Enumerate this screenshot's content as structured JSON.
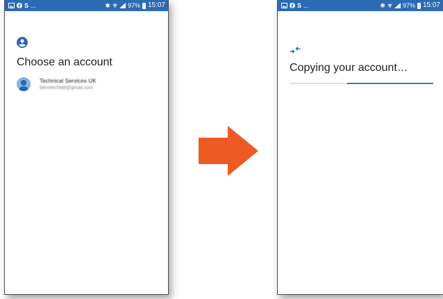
{
  "left_screen": {
    "status_bar": {
      "left_icons": [
        "image-icon",
        "facebook-icon",
        "s-icon",
        "more-dots"
      ],
      "left_s": "S",
      "left_dots": "...",
      "right": {
        "bluetooth": "✱",
        "battery": "97%",
        "time": "15:07"
      }
    },
    "title": "Choose an account",
    "account": {
      "name": "Technical Services UK",
      "email": "benetechlab@gmail.com"
    }
  },
  "right_screen": {
    "status_bar": {
      "left_s": "S",
      "left_dots": "...",
      "right": {
        "bluetooth": "✱",
        "battery": "97%",
        "time": "15:07"
      }
    },
    "title": "Copying your account…",
    "progress": {
      "buffer_fraction": 1.0,
      "indicator_start_fraction": 0.4,
      "indicator_end_fraction": 1.0
    }
  },
  "colors": {
    "status_bar": "#2c6ab4",
    "accent": "#2a67b1",
    "arrow": "#ee5a24"
  }
}
